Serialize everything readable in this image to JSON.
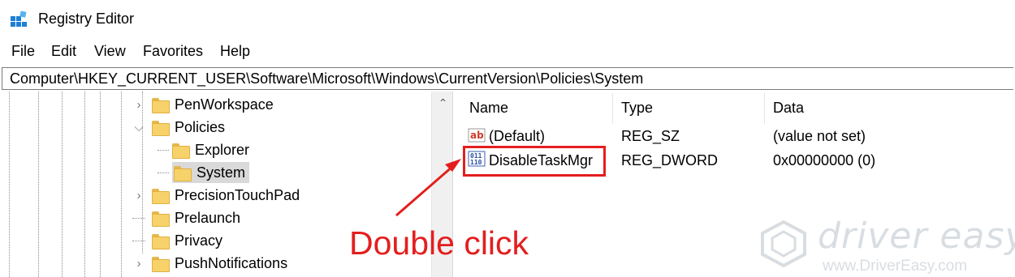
{
  "window": {
    "title": "Registry Editor",
    "icon": "regedit-icon"
  },
  "menu": {
    "items": [
      "File",
      "Edit",
      "View",
      "Favorites",
      "Help"
    ]
  },
  "address": {
    "path": "Computer\\HKEY_CURRENT_USER\\Software\\Microsoft\\Windows\\CurrentVersion\\Policies\\System"
  },
  "tree": {
    "items": [
      {
        "label": "PenWorkspace",
        "expander": "collapsed"
      },
      {
        "label": "Policies",
        "expander": "expanded"
      },
      {
        "label": "Explorer",
        "expander": "none"
      },
      {
        "label": "System",
        "expander": "none",
        "selected": true
      },
      {
        "label": "PrecisionTouchPad",
        "expander": "collapsed"
      },
      {
        "label": "Prelaunch",
        "expander": "none"
      },
      {
        "label": "Privacy",
        "expander": "none"
      },
      {
        "label": "PushNotifications",
        "expander": "collapsed"
      }
    ]
  },
  "list": {
    "columns": [
      "Name",
      "Type",
      "Data"
    ],
    "rows": [
      {
        "name": "(Default)",
        "type": "REG_SZ",
        "data": "(value not set)",
        "icon": "string-value-icon"
      },
      {
        "name": "DisableTaskMgr",
        "type": "REG_DWORD",
        "data": "0x00000000 (0)",
        "icon": "dword-value-icon"
      }
    ]
  },
  "annotation": {
    "text": "Double click",
    "color": "#e41e1e"
  },
  "watermark": {
    "brand": "driver easy",
    "url": "www.DriverEasy.com"
  }
}
